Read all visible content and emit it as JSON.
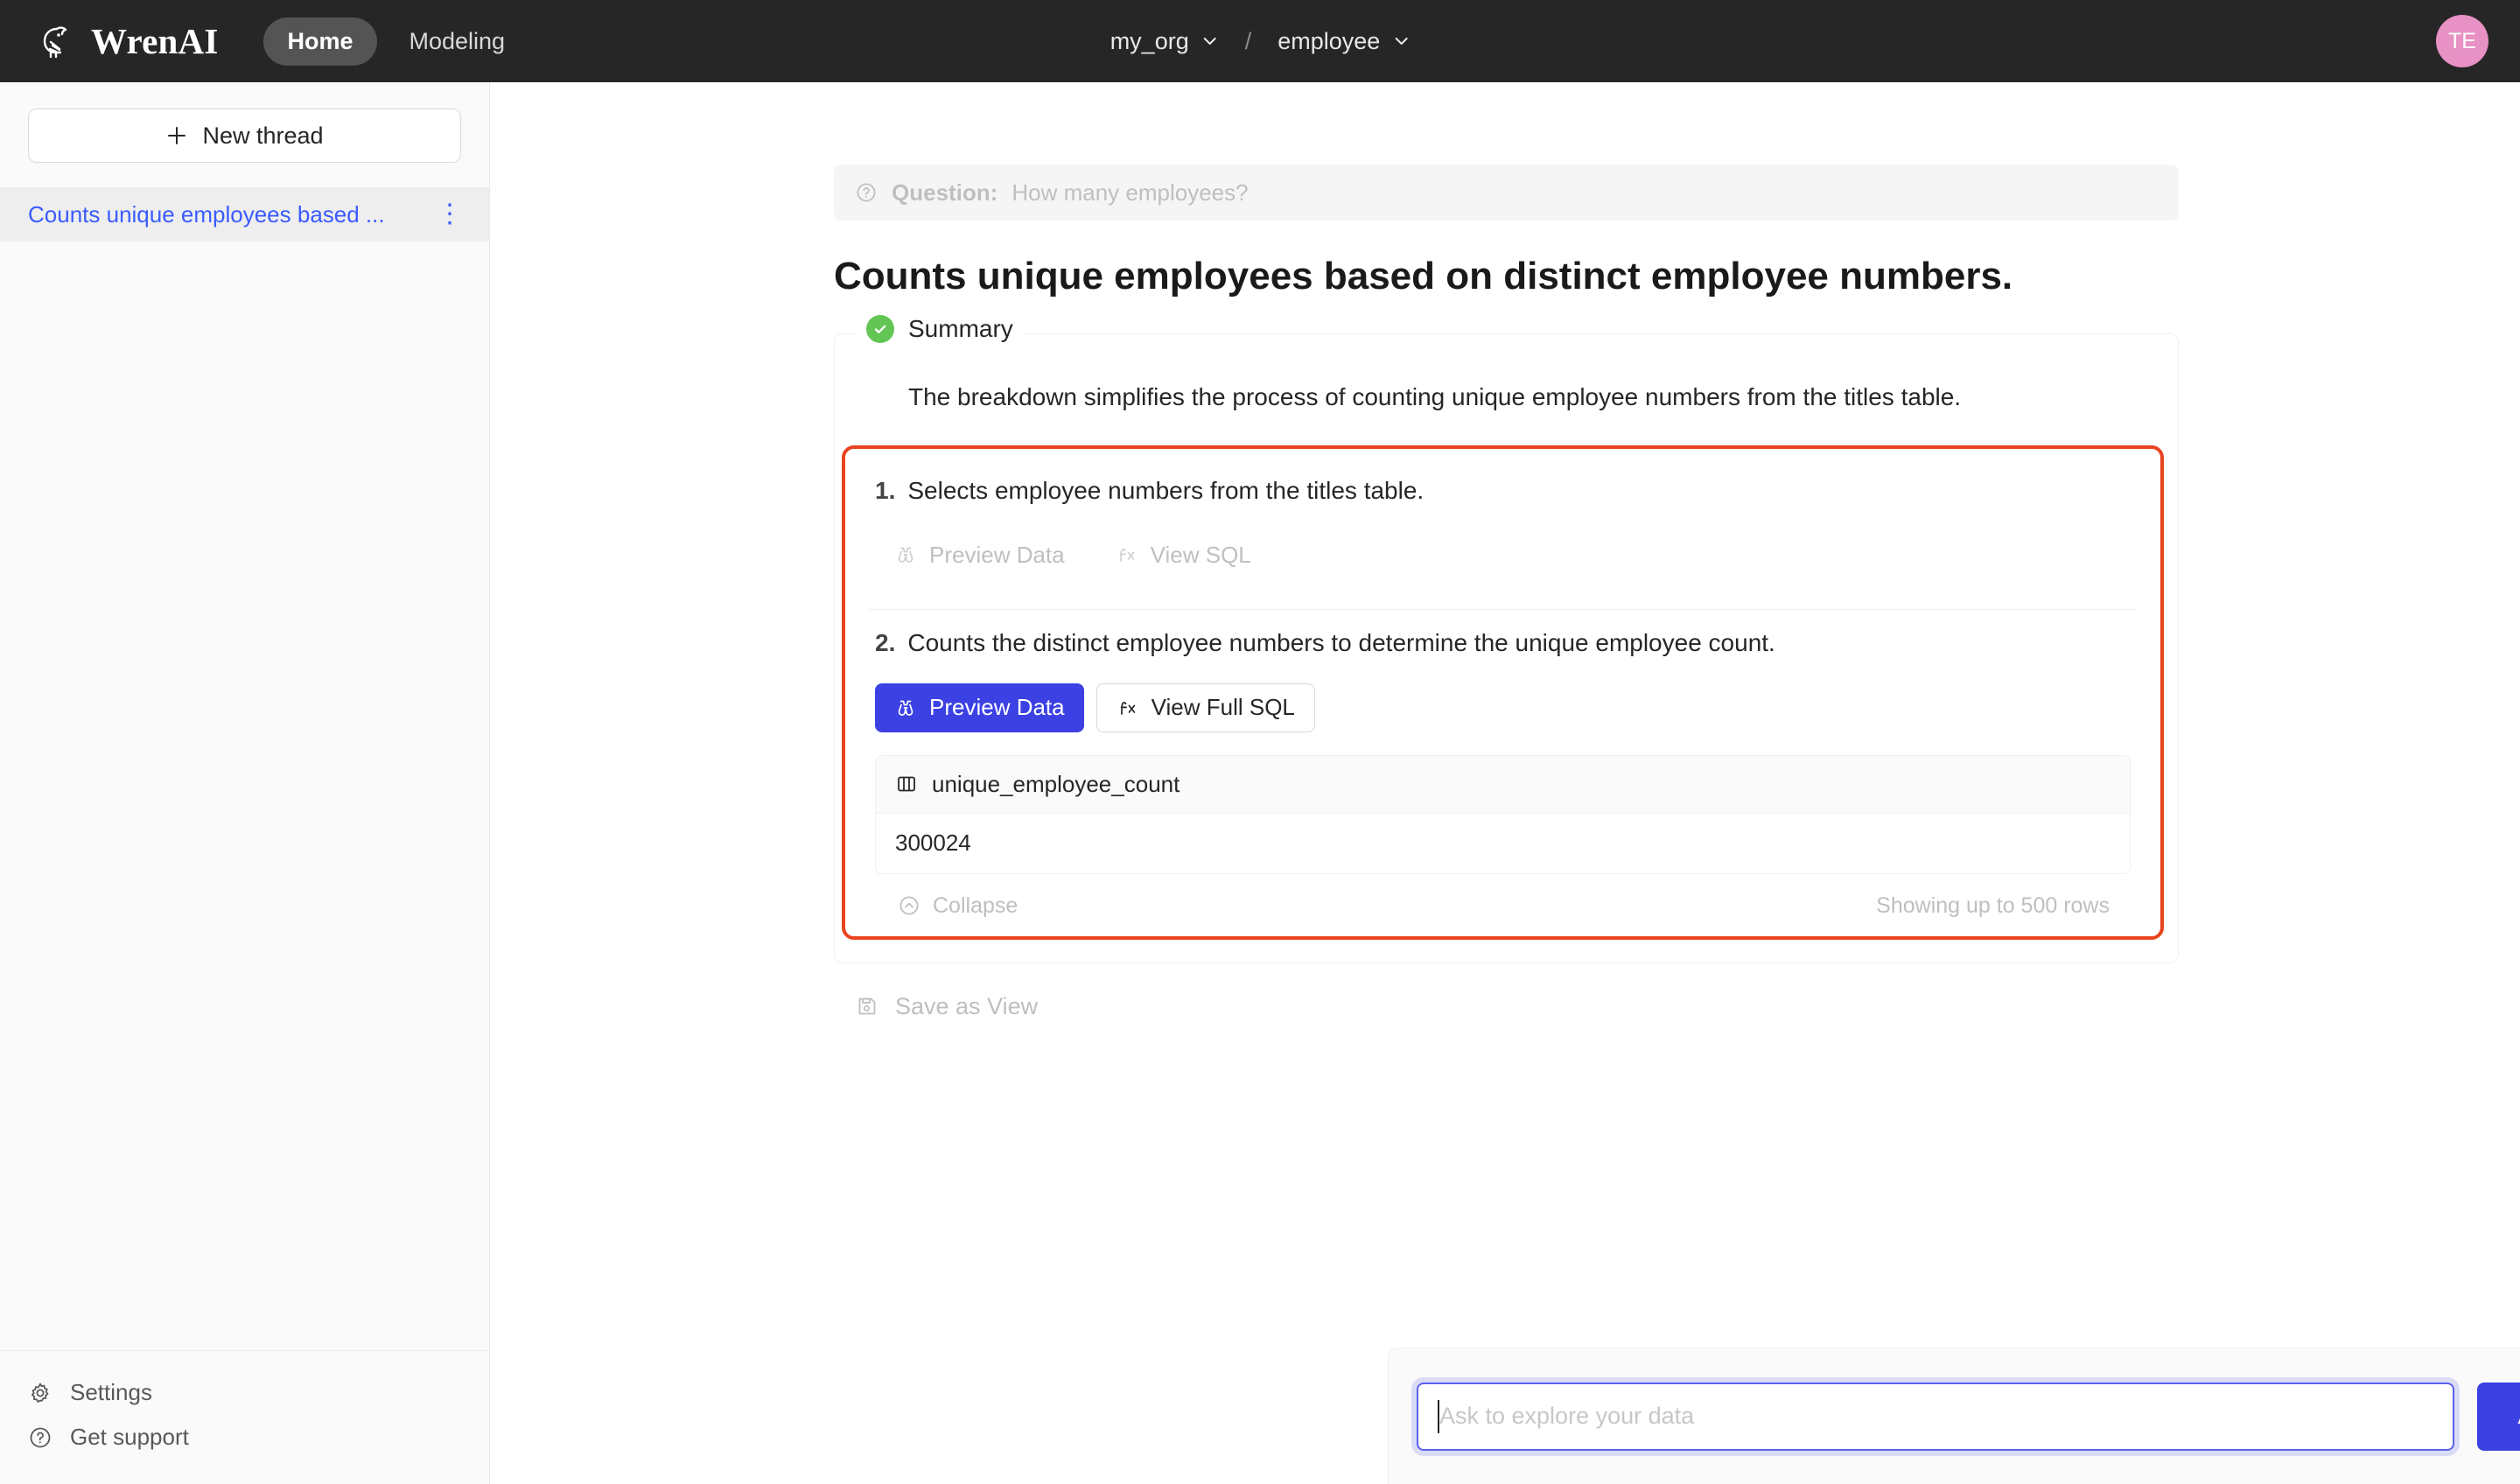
{
  "header": {
    "brand": "WrenAI",
    "logo_icon": "wren-bird-logo-icon",
    "nav": [
      {
        "label": "Home",
        "active": true
      },
      {
        "label": "Modeling",
        "active": false
      }
    ],
    "context": {
      "org": "my_org",
      "separator": "/",
      "dataset": "employee",
      "chevron_icon": "chevron-down-icon"
    },
    "avatar_initials": "TE",
    "avatar_color": "#E791C4"
  },
  "sidebar": {
    "new_thread_label": "New thread",
    "new_thread_icon": "plus-icon",
    "threads": [
      {
        "label": "Counts unique employees based ...",
        "active": true,
        "more_icon": "more-vertical-icon"
      }
    ],
    "bottom_items": [
      {
        "label": "Settings",
        "icon": "gear-icon"
      },
      {
        "label": "Get support",
        "icon": "question-circle-icon"
      }
    ]
  },
  "main": {
    "question_bar": {
      "icon": "question-circle-icon",
      "label": "Question:",
      "text": "How many employees?"
    },
    "answer_title": "Counts unique employees based on distinct employee numbers.",
    "summary": {
      "status_icon": "check-circle-icon",
      "status_color": "#62C554",
      "legend": "Summary",
      "text": "The breakdown simplifies the process of counting unique employee numbers from the titles table."
    },
    "highlight_color": "#E8431F",
    "steps": [
      {
        "number": "1.",
        "text": "Selects employee numbers from the titles table.",
        "actions": [
          {
            "label": "Preview Data",
            "icon": "binoculars-icon",
            "style": "disabled"
          },
          {
            "label": "View SQL",
            "icon": "fx-icon",
            "style": "disabled"
          }
        ]
      },
      {
        "number": "2.",
        "text": "Counts the distinct employee numbers to determine the unique employee count.",
        "actions": [
          {
            "label": "Preview Data",
            "icon": "binoculars-icon",
            "style": "primary"
          },
          {
            "label": "View Full SQL",
            "icon": "fx-icon",
            "style": "default"
          }
        ],
        "result": {
          "column_icon": "table-column-icon",
          "columns": [
            "unique_employee_count"
          ],
          "rows": [
            [
              "300024"
            ]
          ],
          "collapse_label": "Collapse",
          "collapse_icon": "chevron-up-circle-icon",
          "rows_note": "Showing up to 500 rows"
        }
      }
    ],
    "save_as_view": {
      "label": "Save as View",
      "icon": "save-icon"
    }
  },
  "ask_bar": {
    "placeholder": "Ask to explore your data",
    "value": "",
    "button_label": "Ask",
    "accent": "#3B41E3"
  }
}
